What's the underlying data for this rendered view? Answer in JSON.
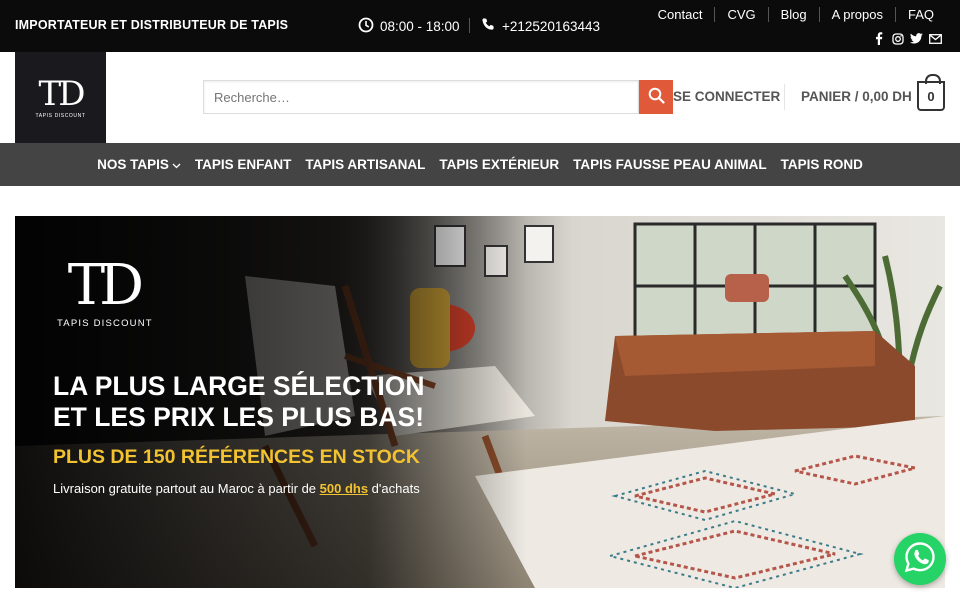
{
  "topbar": {
    "tagline": "IMPORTATEUR ET DISTRIBUTEUR DE TAPIS",
    "hours": "08:00 - 18:00",
    "phone": "+212520163443",
    "links": [
      "Contact",
      "CVG",
      "Blog",
      "A propos",
      "FAQ"
    ],
    "socials": [
      "facebook-icon",
      "instagram-icon",
      "twitter-icon",
      "mail-icon"
    ]
  },
  "header": {
    "logo_text": "TD",
    "logo_subtitle": "TAPIS DISCOUNT",
    "search_placeholder": "Recherche…",
    "login_label": "SE CONNECTER",
    "cart_label": "PANIER / 0,00 DH",
    "cart_count": "0"
  },
  "nav": {
    "items": [
      "NOS TAPIS",
      "TAPIS ENFANT",
      "TAPIS ARTISANAL",
      "TAPIS EXTÉRIEUR",
      "TAPIS FAUSSE PEAU ANIMAL",
      "TAPIS ROND"
    ]
  },
  "hero": {
    "logo_text": "TD",
    "logo_subtitle": "TAPIS DISCOUNT",
    "headline_line1": "LA PLUS LARGE SÉLECTION",
    "headline_line2": "ET LES PRIX LES PLUS BAS!",
    "subheadline": "PLUS DE 150 RÉFÉRENCES EN STOCK",
    "delivery_prefix": "Livraison gratuite partout au Maroc à partir de ",
    "delivery_amount": "500 dhs",
    "delivery_suffix": " d'achats"
  },
  "colors": {
    "topbar_bg": "#0b0b0b",
    "nav_bg": "#444444",
    "accent": "#e05a3a",
    "highlight": "#f2c230",
    "whatsapp": "#25d366"
  }
}
